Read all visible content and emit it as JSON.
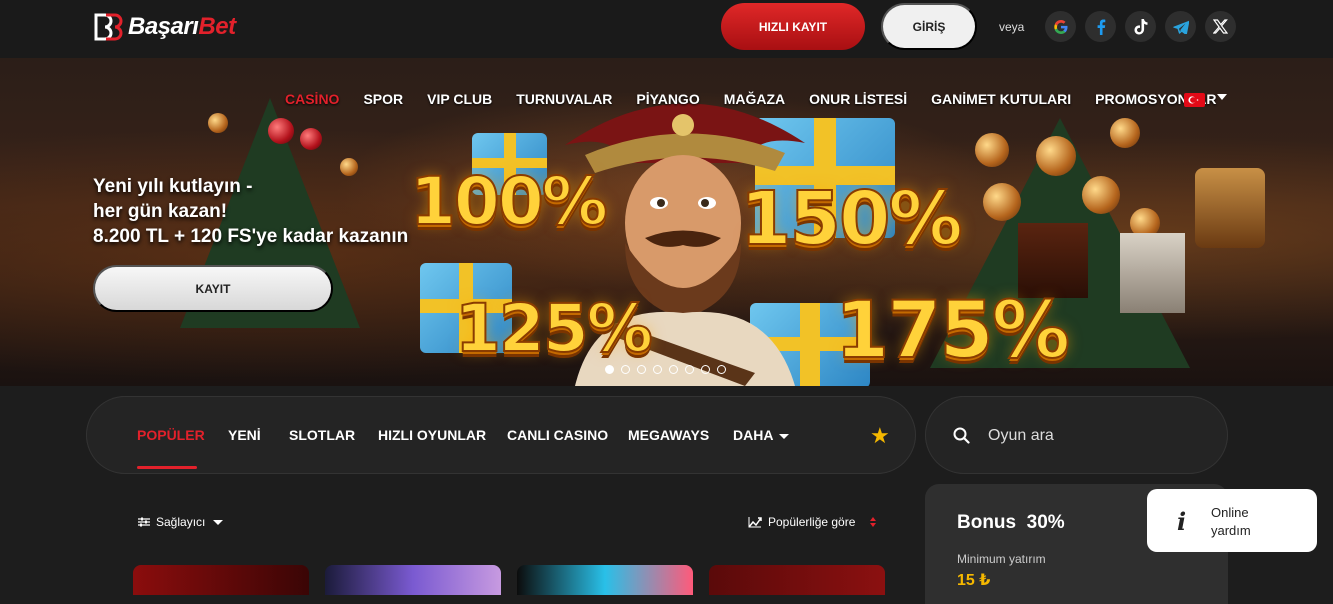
{
  "header": {
    "logo_main": "Başarı",
    "logo_accent": "Bet",
    "register_label": "HIZLI KAYIT",
    "login_label": "GİRİŞ",
    "or_label": "veya",
    "socials": [
      "google-icon",
      "facebook-icon",
      "tiktok-icon",
      "telegram-icon",
      "x-icon"
    ]
  },
  "nav": {
    "items": [
      "CASİNO",
      "SPOR",
      "VIP CLUB",
      "TURNUVALAR",
      "PİYANGO",
      "MAĞAZA",
      "ONUR LİSTESİ",
      "GANİMET KUTULARI",
      "PROMOSYONLAR"
    ],
    "active_index": 0,
    "language": "TR"
  },
  "hero": {
    "line1": "Yeni yılı kutlayın -",
    "line2": "her gün kazan!",
    "line3": "8.200 TL + 120 FS'ye kadar kazanın",
    "cta": "KAYIT",
    "badges": [
      "100%",
      "150%",
      "125%",
      "175%"
    ],
    "slides_total": 8,
    "slide_active": 1
  },
  "categories": {
    "items": [
      "POPÜLER",
      "YENİ",
      "SLOTLAR",
      "HIZLI OYUNLAR",
      "CANLI CASINO",
      "MEGAWAYS",
      "DAHA"
    ],
    "active_index": 0
  },
  "search": {
    "placeholder": "Oyun ara"
  },
  "filters": {
    "provider_label": "Sağlayıcı",
    "sort_label": "Popülerliğe göre"
  },
  "bonus": {
    "title": "Bonus",
    "percent": "30%",
    "min_label": "Minimum yatırım",
    "min_value": "15 ₺"
  },
  "help": {
    "line1": "Online",
    "line2": "yardım"
  },
  "colors": {
    "accent": "#e2212b",
    "star": "#f5b800",
    "bg": "#1d1d1d"
  }
}
